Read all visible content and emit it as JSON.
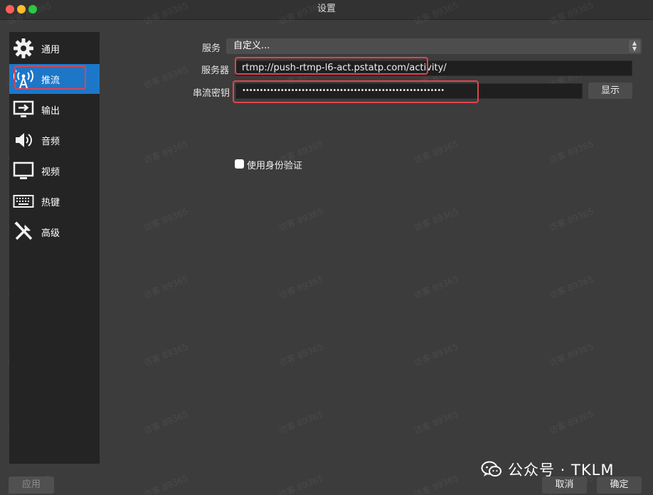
{
  "window": {
    "title": "设置"
  },
  "sidebar": {
    "items": [
      {
        "label": "通用",
        "icon": "gear-icon"
      },
      {
        "label": "推流",
        "icon": "broadcast-tower-icon",
        "active": true
      },
      {
        "label": "输出",
        "icon": "output-monitor-icon"
      },
      {
        "label": "音频",
        "icon": "speaker-icon"
      },
      {
        "label": "视频",
        "icon": "monitor-icon"
      },
      {
        "label": "热键",
        "icon": "keyboard-icon"
      },
      {
        "label": "高级",
        "icon": "tools-icon"
      }
    ]
  },
  "form": {
    "service_label": "服务",
    "service_value": "自定义...",
    "server_label": "服务器",
    "server_value": "rtmp://push-rtmp-l6-act.pstatp.com/activity/",
    "stream_key_label": "串流密钥",
    "stream_key_value": "••••••••••••••••••••••••••••••••••••••••••••••••••••••••••",
    "show_button": "显示",
    "auth_checkbox_label": "使用身份验证",
    "auth_checked": false
  },
  "footer": {
    "apply": "应用",
    "cancel": "取消",
    "ok": "确定",
    "brand": "公众号 · TKLM"
  },
  "watermark": "访客 89365",
  "colors": {
    "accent": "#1d77c9",
    "highlight": "#e0434e",
    "background": "#3c3c3c",
    "sidebar": "#242424"
  }
}
